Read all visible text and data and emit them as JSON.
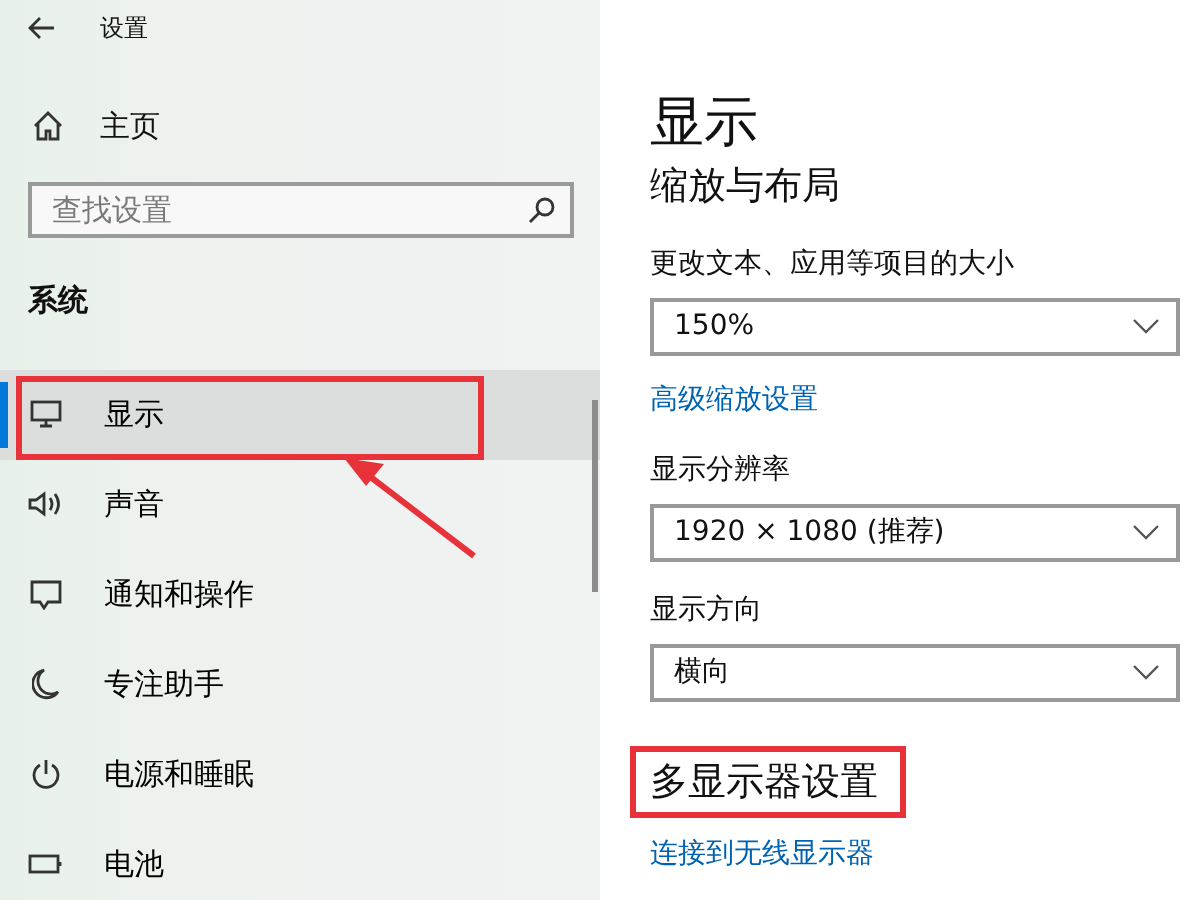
{
  "window": {
    "title": "设置"
  },
  "sidebar": {
    "home": "主页",
    "search": {
      "placeholder": "查找设置"
    },
    "section": "系统",
    "items": [
      {
        "label": "显示",
        "selected": true,
        "outlined": true
      },
      {
        "label": "声音",
        "selected": false,
        "outlined": false
      },
      {
        "label": "通知和操作",
        "selected": false,
        "outlined": false
      },
      {
        "label": "专注助手",
        "selected": false,
        "outlined": false
      },
      {
        "label": "电源和睡眠",
        "selected": false,
        "outlined": false
      },
      {
        "label": "电池",
        "selected": false,
        "outlined": false
      }
    ]
  },
  "content": {
    "title": "显示",
    "blocks": [
      {
        "kind": "subheading",
        "text": "缩放与布局",
        "outlined": false
      },
      {
        "kind": "label",
        "text": "更改文本、应用等项目的大小"
      },
      {
        "kind": "dropdown",
        "value": "150%"
      },
      {
        "kind": "link",
        "text": "高级缩放设置"
      },
      {
        "kind": "label",
        "text": "显示分辨率"
      },
      {
        "kind": "dropdown",
        "value": "1920 × 1080 (推荐)"
      },
      {
        "kind": "label",
        "text": "显示方向"
      },
      {
        "kind": "dropdown",
        "value": "横向"
      },
      {
        "kind": "subheading",
        "text": "多显示器设置",
        "outlined": true
      },
      {
        "kind": "link",
        "text": "连接到无线显示器"
      }
    ]
  }
}
